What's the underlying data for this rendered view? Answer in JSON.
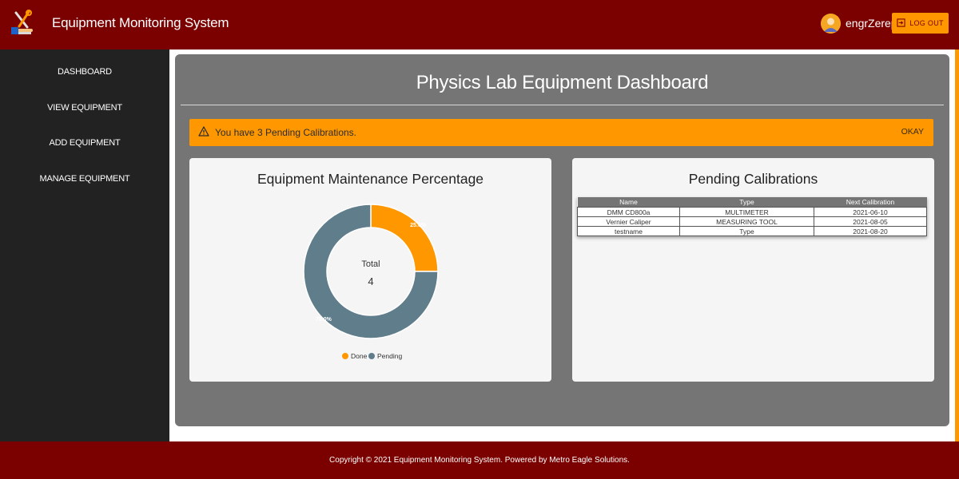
{
  "header": {
    "app_title": "Equipment Monitoring System",
    "username": "engrZerep",
    "logout_label": "LOG OUT"
  },
  "sidebar": {
    "items": [
      {
        "label": "DASHBOARD"
      },
      {
        "label": "VIEW EQUIPMENT"
      },
      {
        "label": "ADD EQUIPMENT"
      },
      {
        "label": "MANAGE EQUIPMENT"
      }
    ]
  },
  "main": {
    "page_title": "Physics Lab Equipment Dashboard",
    "alert": {
      "text": "You have 3 Pending Calibrations.",
      "action_label": "OKAY"
    }
  },
  "maintenance_card": {
    "title": "Equipment Maintenance Percentage",
    "center_label": "Total",
    "center_value": "4"
  },
  "calibrations_card": {
    "title": "Pending Calibrations",
    "columns": [
      "Name",
      "Type",
      "Next Calibration"
    ],
    "rows": [
      [
        "DMM CD800a",
        "MULTIMETER",
        "2021-06-10"
      ],
      [
        "Vernier Caliper",
        "MEASURING TOOL",
        "2021-08-05"
      ],
      [
        "testname",
        "Type",
        "2021-08-20"
      ]
    ]
  },
  "footer": {
    "text": "Copyright © 2021 Equipment Monitoring System. Powered by Metro Eagle Solutions."
  },
  "chart_data": {
    "type": "pie",
    "title": "Equipment Maintenance Percentage",
    "categories": [
      "Done",
      "Pending"
    ],
    "values": [
      25.0,
      75.0
    ],
    "labels": [
      "25.0%",
      "75.0%"
    ],
    "colors": [
      "#ff9800",
      "#607d8b"
    ],
    "legend": "bottom"
  },
  "colors": {
    "header_bg": "#7b0000",
    "accent": "#ff9800",
    "sidebar_bg": "#222222",
    "panel_bg": "#757575",
    "pending": "#607d8b"
  },
  "icons": {
    "logo": "tools-logo-icon",
    "logout": "logout-icon",
    "alert": "warning-icon",
    "avatar": "user-avatar-icon"
  }
}
